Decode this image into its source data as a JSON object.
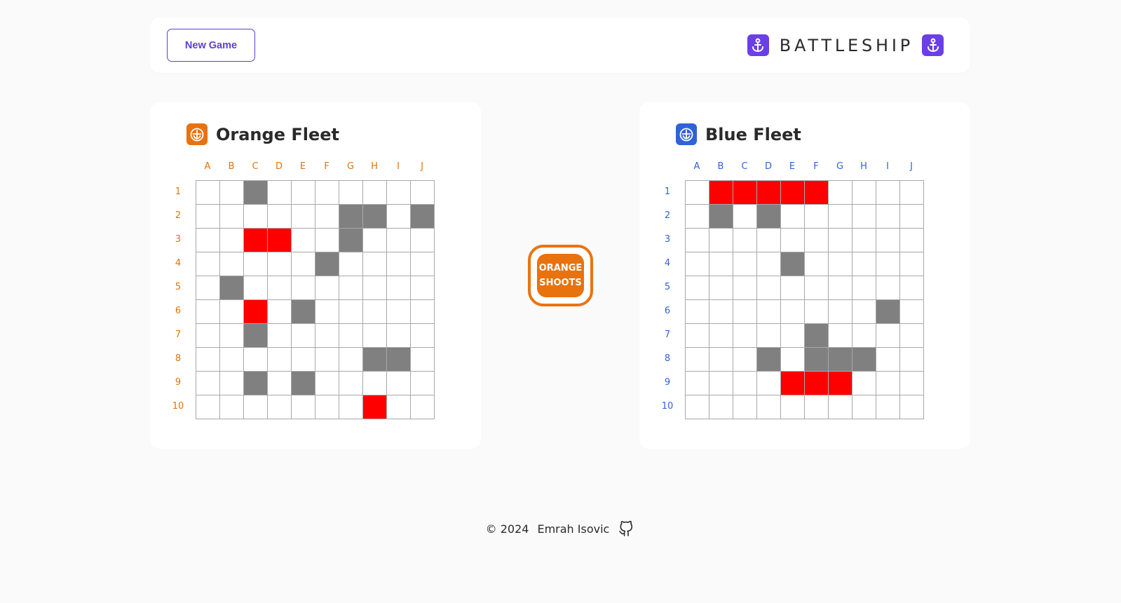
{
  "header": {
    "new_game_label": "New Game",
    "title": "BATTLESHIP",
    "brand_icon": "anchor-icon",
    "brand_color": "#6b3fe6"
  },
  "orange_fleet": {
    "title": "Orange Fleet",
    "icon": "ship-icon",
    "color": "#e0740a",
    "columns": [
      "A",
      "B",
      "C",
      "D",
      "E",
      "F",
      "G",
      "H",
      "I",
      "J"
    ],
    "rows": [
      "1",
      "2",
      "3",
      "4",
      "5",
      "6",
      "7",
      "8",
      "9",
      "10"
    ],
    "grid": [
      [
        "empty",
        "empty",
        "ship",
        "empty",
        "empty",
        "empty",
        "empty",
        "empty",
        "empty",
        "empty"
      ],
      [
        "empty",
        "empty",
        "empty",
        "empty",
        "empty",
        "empty",
        "ship",
        "ship",
        "empty",
        "ship"
      ],
      [
        "empty",
        "empty",
        "hit",
        "hit",
        "empty",
        "empty",
        "ship",
        "empty",
        "empty",
        "empty"
      ],
      [
        "empty",
        "empty",
        "empty",
        "empty",
        "empty",
        "ship",
        "empty",
        "empty",
        "empty",
        "empty"
      ],
      [
        "empty",
        "ship",
        "empty",
        "empty",
        "empty",
        "empty",
        "empty",
        "empty",
        "empty",
        "empty"
      ],
      [
        "empty",
        "empty",
        "hit",
        "empty",
        "ship",
        "empty",
        "empty",
        "empty",
        "empty",
        "empty"
      ],
      [
        "empty",
        "empty",
        "ship",
        "empty",
        "empty",
        "empty",
        "empty",
        "empty",
        "empty",
        "empty"
      ],
      [
        "empty",
        "empty",
        "empty",
        "empty",
        "empty",
        "empty",
        "empty",
        "ship",
        "ship",
        "empty"
      ],
      [
        "empty",
        "empty",
        "ship",
        "empty",
        "ship",
        "empty",
        "empty",
        "empty",
        "empty",
        "empty"
      ],
      [
        "empty",
        "empty",
        "empty",
        "empty",
        "empty",
        "empty",
        "empty",
        "hit",
        "empty",
        "empty"
      ]
    ]
  },
  "blue_fleet": {
    "title": "Blue Fleet",
    "icon": "ship-icon",
    "color": "#2f63d8",
    "columns": [
      "A",
      "B",
      "C",
      "D",
      "E",
      "F",
      "G",
      "H",
      "I",
      "J"
    ],
    "rows": [
      "1",
      "2",
      "3",
      "4",
      "5",
      "6",
      "7",
      "8",
      "9",
      "10"
    ],
    "grid": [
      [
        "empty",
        "hit",
        "hit",
        "hit",
        "hit",
        "hit",
        "empty",
        "empty",
        "empty",
        "empty"
      ],
      [
        "empty",
        "ship",
        "empty",
        "ship",
        "empty",
        "empty",
        "empty",
        "empty",
        "empty",
        "empty"
      ],
      [
        "empty",
        "empty",
        "empty",
        "empty",
        "empty",
        "empty",
        "empty",
        "empty",
        "empty",
        "empty"
      ],
      [
        "empty",
        "empty",
        "empty",
        "empty",
        "ship",
        "empty",
        "empty",
        "empty",
        "empty",
        "empty"
      ],
      [
        "empty",
        "empty",
        "empty",
        "empty",
        "empty",
        "empty",
        "empty",
        "empty",
        "empty",
        "empty"
      ],
      [
        "empty",
        "empty",
        "empty",
        "empty",
        "empty",
        "empty",
        "empty",
        "empty",
        "ship",
        "empty"
      ],
      [
        "empty",
        "empty",
        "empty",
        "empty",
        "empty",
        "ship",
        "empty",
        "empty",
        "empty",
        "empty"
      ],
      [
        "empty",
        "empty",
        "empty",
        "ship",
        "empty",
        "ship",
        "ship",
        "ship",
        "empty",
        "empty"
      ],
      [
        "empty",
        "empty",
        "empty",
        "empty",
        "hit",
        "hit",
        "hit",
        "empty",
        "empty",
        "empty"
      ],
      [
        "empty",
        "empty",
        "empty",
        "empty",
        "empty",
        "empty",
        "empty",
        "empty",
        "empty",
        "empty"
      ]
    ]
  },
  "turn": {
    "line1": "ORANGE",
    "line2": "SHOOTS",
    "color": "#e8720e"
  },
  "cell_colors": {
    "empty": "#ffffff",
    "ship": "#808080",
    "hit": "#ff0000"
  },
  "footer": {
    "copyright": "© 2024",
    "author": "Emrah Isovic",
    "icon": "github-icon"
  }
}
